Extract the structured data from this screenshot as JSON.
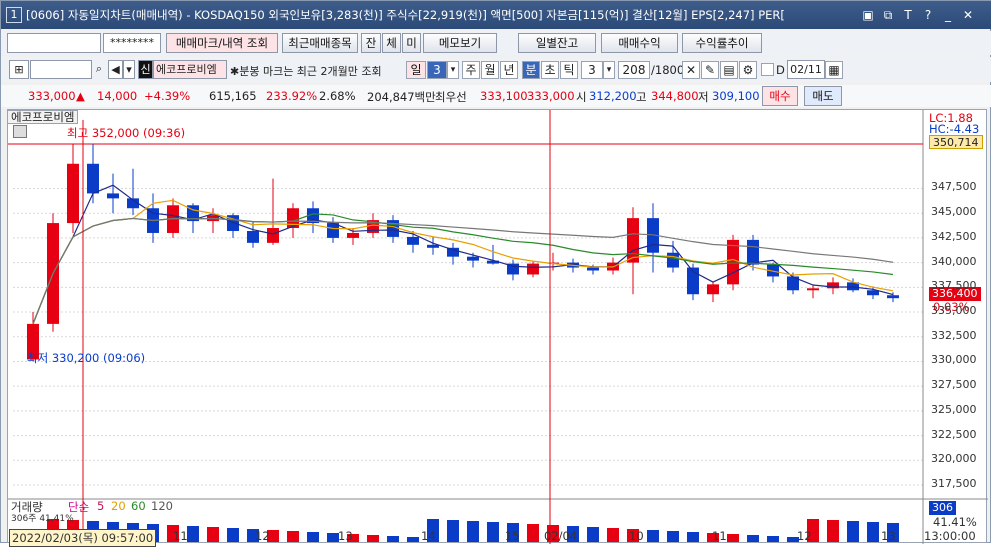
{
  "titlebar": {
    "num": "1",
    "title": "[0606] 자동일지차트(매매내역) - KOSDAQ150 외국인보유[3,283(천)] 주식수[22,919(천)] 액면[500] 자본금[115(억)] 결산[12월] EPS[2,247] PER[",
    "icons": [
      "tile-icon",
      "link-icon",
      "font-icon",
      "tool-icon",
      "minimize-icon",
      "close-icon"
    ]
  },
  "toolbar1": {
    "account_mask": "********",
    "buttons": [
      "매매마크/내역 조회",
      "최근매매종목",
      "잔",
      "체",
      "미",
      "메모보기",
      "일별잔고",
      "매매수익",
      "수익률추이"
    ]
  },
  "toolbar2": {
    "stock_badge": "신",
    "stock_name": "에코프로비엠",
    "note": "✱분봉 마크는 최근 2개월만 조회",
    "period_label": "일",
    "period_num": "3",
    "periods": [
      "주",
      "월",
      "년",
      "분",
      "초",
      "틱"
    ],
    "tick_value": "3",
    "count": "208",
    "count_max": "/1800",
    "date_label": "D",
    "date": "02/11"
  },
  "quote": {
    "price": "333,000",
    "change_arrow": "▲",
    "change": "14,000",
    "change_pct": "+4.39%",
    "volume": "615,165",
    "vol_pct": "233.92%",
    "turnover_pct": "2.68%",
    "amount": "204,847백만",
    "best_ask_label": "최우선",
    "best_ask": "333,100",
    "best_bid": "333,000",
    "open_label": "시",
    "open": "312,200",
    "high_label": "고",
    "high": "344,800",
    "low_label": "저",
    "low": "309,100",
    "buy": "매수",
    "sell": "매도"
  },
  "chart": {
    "stock_tab": "에코프로비엠",
    "max_label": "최고 352,000 (09:36)",
    "min_label": "최저 330,200 (09:06)",
    "lc": "LC:1.88",
    "hc": "HC:-4.43",
    "top_value": "350,714",
    "current_value": "336,400",
    "current_pct": "0.03%",
    "y_ticks": [
      "347,500",
      "345,000",
      "342,500",
      "340,000",
      "337,500",
      "335,000",
      "332,500",
      "330,000",
      "327,500",
      "325,000",
      "322,500",
      "320,000",
      "317,500"
    ],
    "x_ticks": [
      "11",
      "12",
      "13",
      "14",
      "15",
      "02/04",
      "10",
      "11",
      "12",
      "13",
      "13:00:00"
    ],
    "start_date": "2022/02/03(목) 09:57:00",
    "volume_legend": "거래량",
    "volume_ma_label": "단순",
    "volume_ma": [
      "5",
      "20",
      "60",
      "120"
    ],
    "vol_value": "306",
    "vol_pct": "41.41%",
    "vol_small": "306주 41.41%"
  },
  "chart_data": {
    "type": "candlestick",
    "ylim": [
      317500,
      352000
    ],
    "series": [
      {
        "name": "price",
        "values": [
          [
            330200,
            335000,
            330000,
            333800
          ],
          [
            333800,
            345000,
            333000,
            344000
          ],
          [
            344000,
            352000,
            343000,
            350000
          ],
          [
            350000,
            352000,
            346000,
            347000
          ],
          [
            347000,
            349000,
            345000,
            346500
          ],
          [
            346500,
            349500,
            344800,
            345500
          ],
          [
            345500,
            347000,
            342000,
            343000
          ],
          [
            343000,
            346500,
            342500,
            345800
          ],
          [
            345800,
            346000,
            343000,
            344200
          ],
          [
            344200,
            345500,
            343000,
            344800
          ],
          [
            344800,
            345000,
            342500,
            343200
          ],
          [
            343200,
            344200,
            341500,
            342000
          ],
          [
            342000,
            348500,
            341800,
            343500
          ],
          [
            343500,
            346000,
            342500,
            345500
          ],
          [
            345500,
            346200,
            343000,
            344000
          ],
          [
            344000,
            344600,
            342000,
            342500
          ],
          [
            342500,
            343500,
            341800,
            343000
          ],
          [
            343000,
            345000,
            342500,
            344300
          ],
          [
            344300,
            344800,
            342000,
            342600
          ],
          [
            342600,
            343200,
            341000,
            341800
          ],
          [
            341800,
            342600,
            340800,
            341500
          ],
          [
            341500,
            342000,
            339800,
            340600
          ],
          [
            340600,
            341000,
            339500,
            340200
          ],
          [
            340200,
            341800,
            339800,
            339900
          ],
          [
            339900,
            340300,
            338200,
            338800
          ],
          [
            338800,
            340100,
            338500,
            339900
          ],
          [
            339900,
            341000,
            339200,
            340000
          ],
          [
            340000,
            340400,
            339000,
            339500
          ],
          [
            339500,
            339800,
            338800,
            339200
          ],
          [
            339200,
            340500,
            338800,
            340000
          ],
          [
            340000,
            345600,
            336800,
            344500
          ],
          [
            344500,
            346000,
            339000,
            341000
          ],
          [
            341000,
            342200,
            339000,
            339500
          ],
          [
            339500,
            339900,
            336200,
            336800
          ],
          [
            336800,
            338000,
            336000,
            337800
          ],
          [
            337800,
            342800,
            337200,
            342300
          ],
          [
            342300,
            342800,
            339200,
            339800
          ],
          [
            339800,
            340000,
            338000,
            338600
          ],
          [
            338600,
            339000,
            336800,
            337200
          ],
          [
            337200,
            337800,
            336400,
            337400
          ],
          [
            337400,
            338500,
            336800,
            338000
          ],
          [
            338000,
            338400,
            337000,
            337200
          ],
          [
            337200,
            337600,
            336300,
            336700
          ],
          [
            336700,
            337000,
            336000,
            336400
          ]
        ]
      }
    ]
  }
}
